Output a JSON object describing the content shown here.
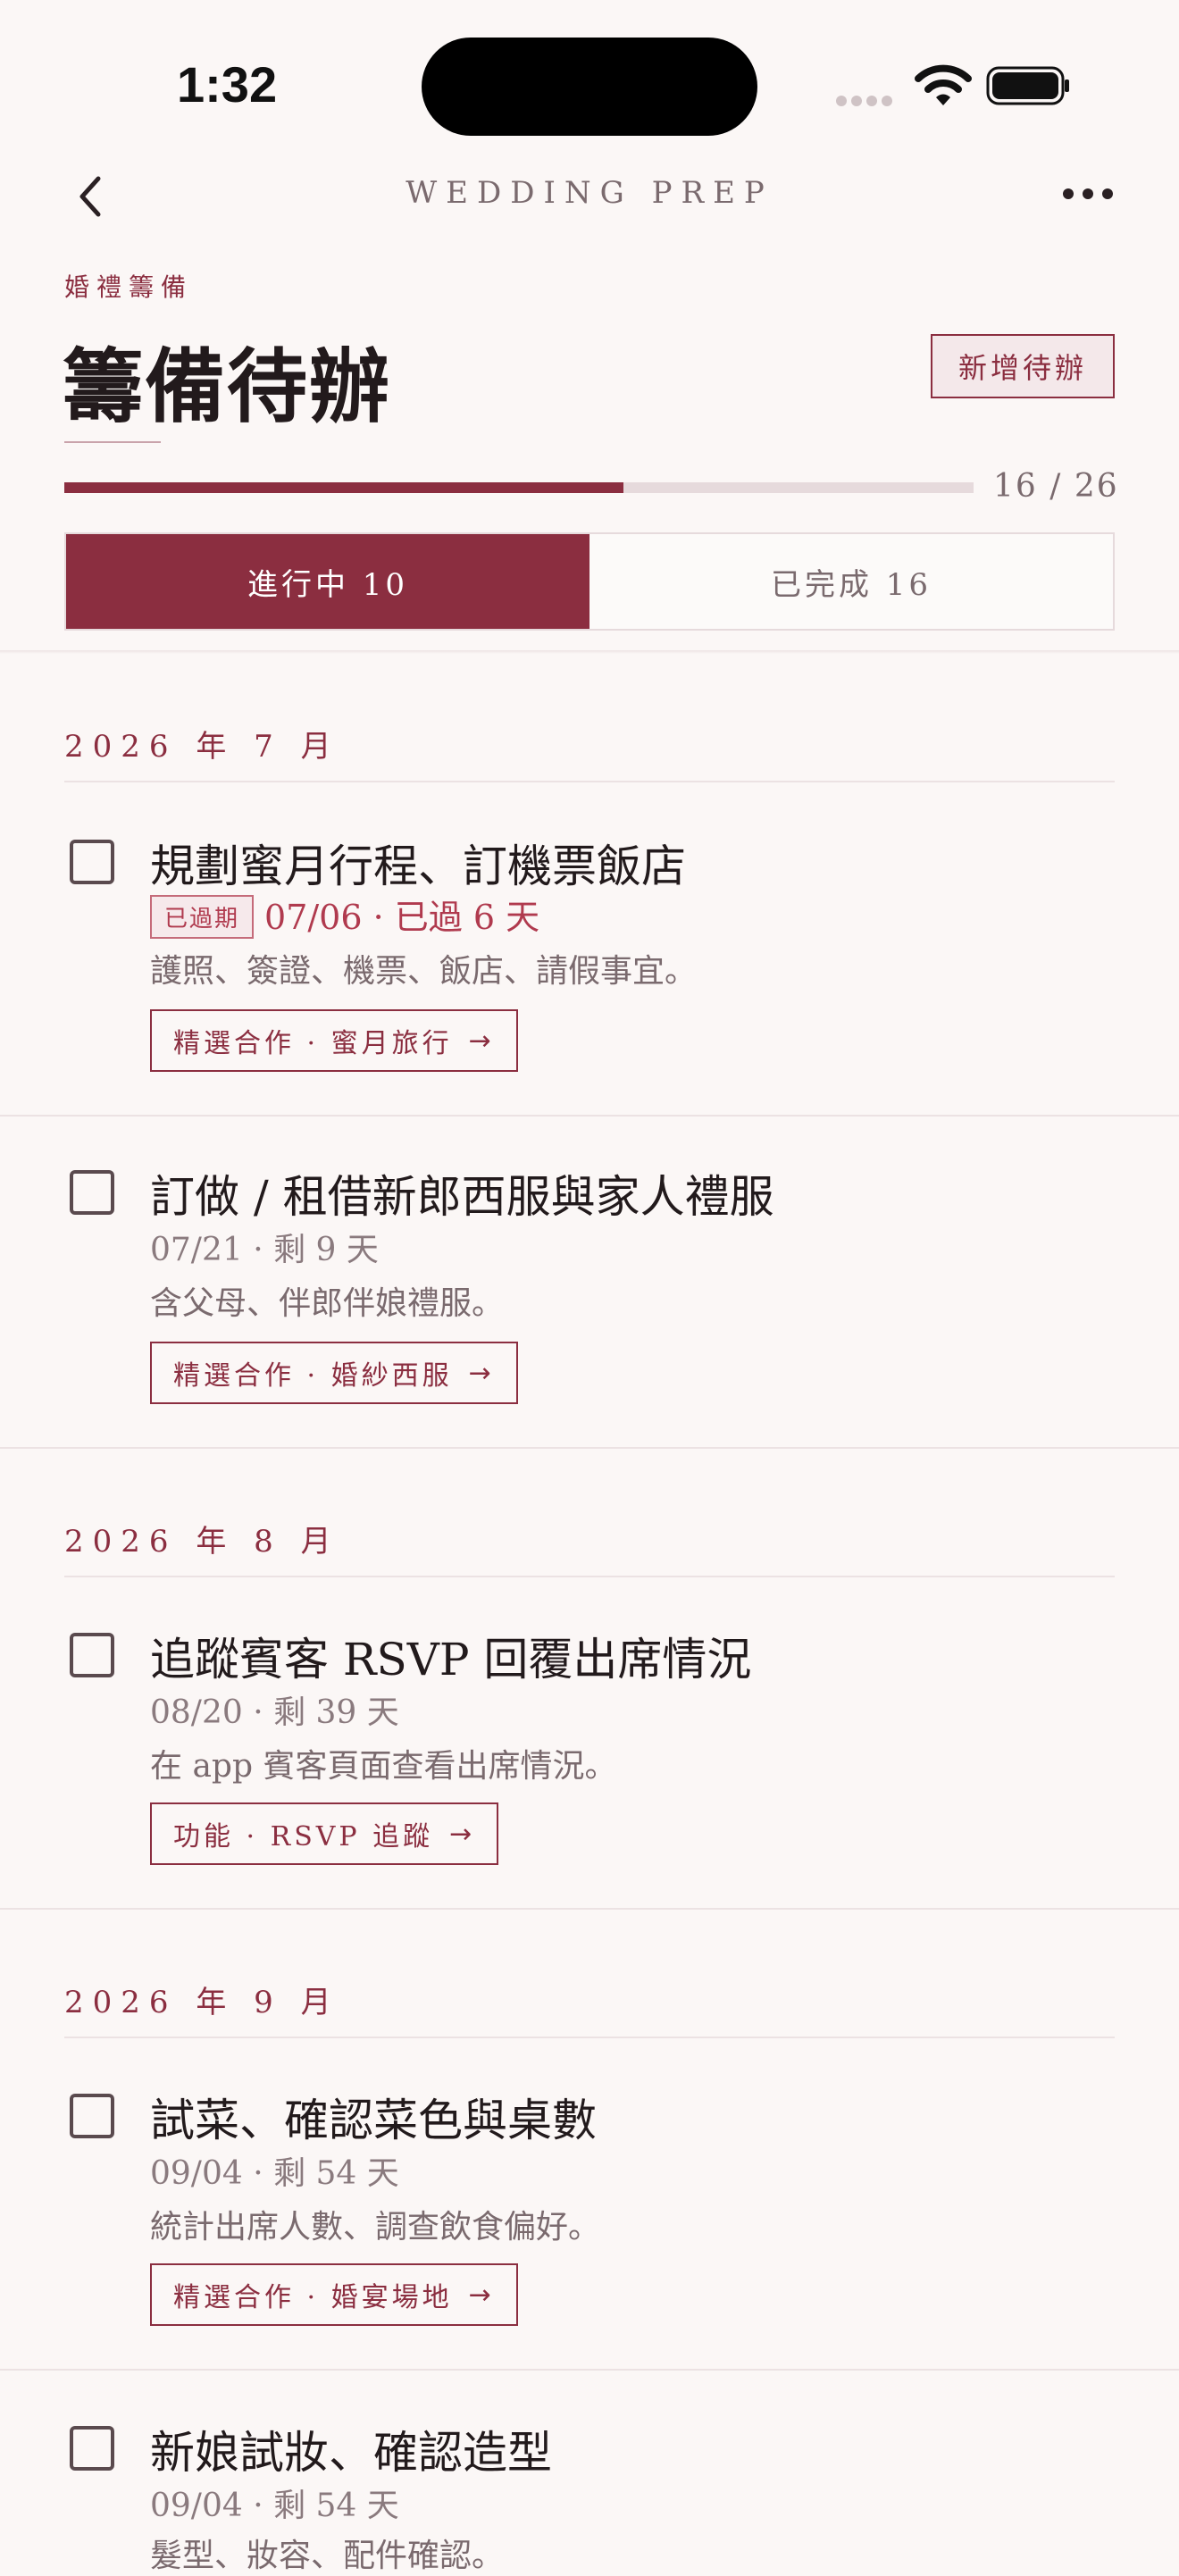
{
  "status_bar": {
    "time": "1:32"
  },
  "nav": {
    "title": "WEDDING PREP"
  },
  "header": {
    "eyebrow": "婚禮籌備",
    "title": "籌備待辦",
    "add_button": "新增待辦",
    "progress": {
      "done": 16,
      "total": 26,
      "label": "16 / 26"
    }
  },
  "tabs": [
    {
      "label": "進行中  10",
      "active": true
    },
    {
      "label": "已完成  16",
      "active": false
    }
  ],
  "groups": [
    {
      "month": "2026 年 7 月",
      "tasks": [
        {
          "title": "規劃蜜月行程、訂機票飯店",
          "badge": "已過期",
          "due": "07/06 · 已過 6 天",
          "desc": "護照、簽證、機票、飯店、請假事宜。",
          "link": "精選合作 · 蜜月旅行"
        },
        {
          "title": "訂做 / 租借新郎西服與家人禮服",
          "due": "07/21 · 剩 9 天",
          "desc": "含父母、伴郎伴娘禮服。",
          "link": "精選合作 · 婚紗西服"
        }
      ]
    },
    {
      "month": "2026 年 8 月",
      "tasks": [
        {
          "title": "追蹤賓客 RSVP 回覆出席情況",
          "due": "08/20 · 剩 39 天",
          "desc": "在 app 賓客頁面查看出席情況。",
          "link": "功能 · RSVP 追蹤"
        }
      ]
    },
    {
      "month": "2026 年 9 月",
      "tasks": [
        {
          "title": "試菜、確認菜色與桌數",
          "due": "09/04 · 剩 54 天",
          "desc": "統計出席人數、調查飲食偏好。",
          "link": "精選合作 · 婚宴場地"
        },
        {
          "title": "新娘試妝、確認造型",
          "due": "09/04 · 剩 54 天",
          "desc": "髮型、妝容、配件確認。"
        }
      ]
    }
  ],
  "colors": {
    "accent": "#8B2E40",
    "background": "#FBF7F6",
    "overdue": "#B03A4E"
  },
  "icons": {
    "back": "chevron-left-icon",
    "more": "ellipsis-icon",
    "link": "arrow-right-icon",
    "check": "checkbox-icon"
  }
}
